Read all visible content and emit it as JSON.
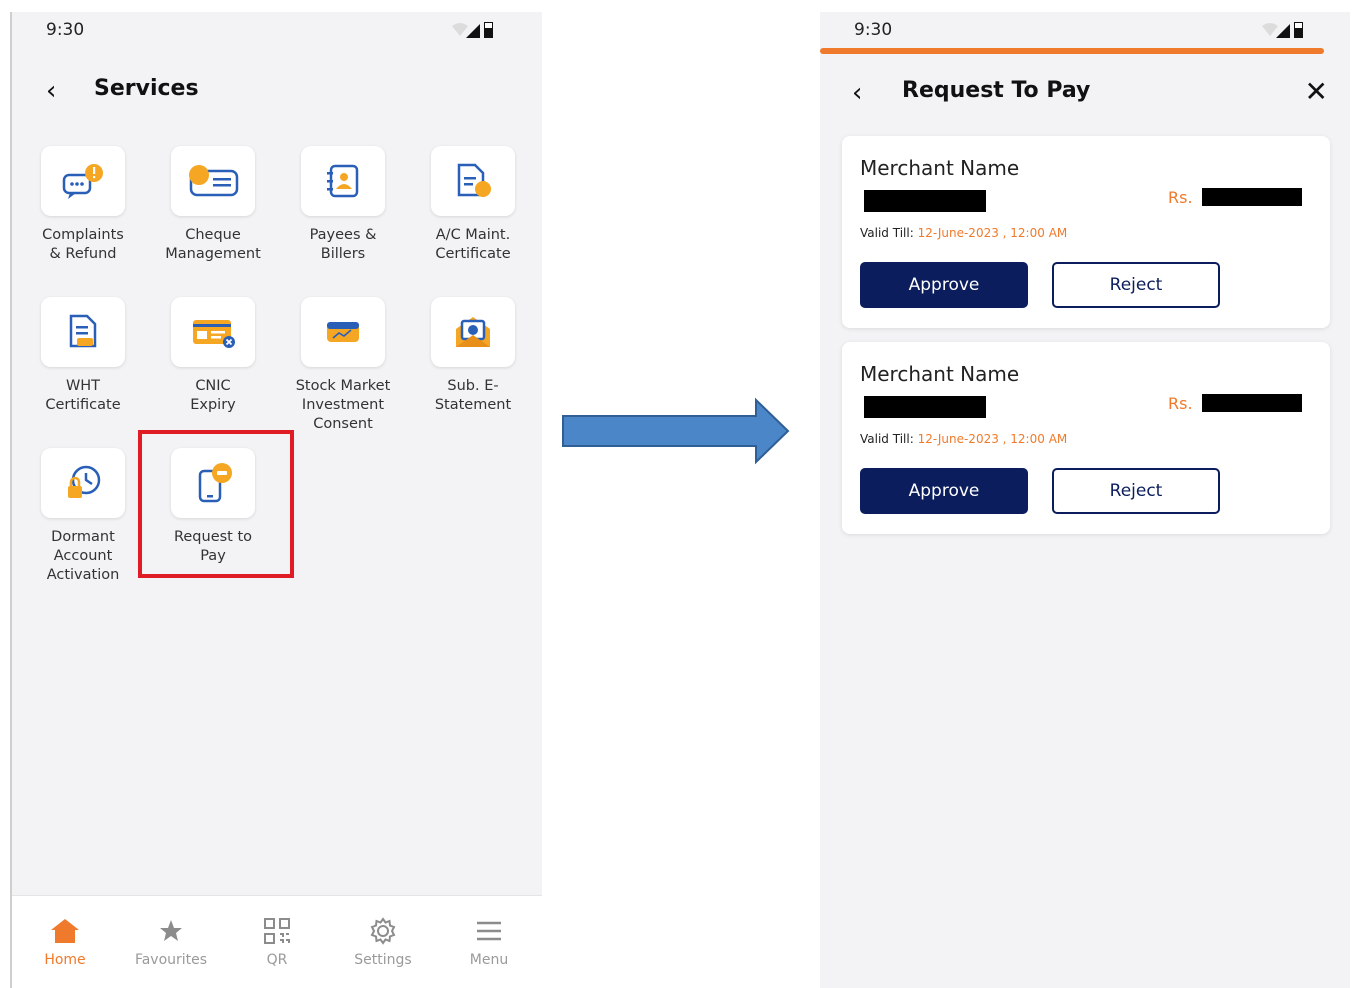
{
  "left_screen": {
    "status_time": "9:30",
    "title": "Services",
    "services": [
      {
        "label": "Complaints\n& Refund",
        "icon": "complaint-chat-icon"
      },
      {
        "label": "Cheque\nManagement",
        "icon": "cheque-icon"
      },
      {
        "label": "Payees &\nBillers",
        "icon": "payee-contact-icon"
      },
      {
        "label": "A/C Maint.\nCertificate",
        "icon": "certificate-document-icon"
      },
      {
        "label": "WHT\nCertificate",
        "icon": "tax-document-icon"
      },
      {
        "label": "CNIC\nExpiry",
        "icon": "id-card-icon"
      },
      {
        "label": "Stock Market\nInvestment\nConsent",
        "icon": "stock-chart-icon"
      },
      {
        "label": "Sub. E-\nStatement",
        "icon": "email-statement-icon"
      },
      {
        "label": "Dormant\nAccount\nActivation",
        "icon": "dormant-lock-clock-icon"
      },
      {
        "label": "Request to\nPay",
        "icon": "request-to-pay-phone-icon"
      }
    ],
    "bottom_nav": [
      {
        "label": "Home",
        "icon": "home-icon",
        "active": true
      },
      {
        "label": "Favourites",
        "icon": "star-icon",
        "active": false
      },
      {
        "label": "QR",
        "icon": "qr-code-icon",
        "active": false
      },
      {
        "label": "Settings",
        "icon": "gear-icon",
        "active": false
      },
      {
        "label": "Menu",
        "icon": "hamburger-menu-icon",
        "active": false
      }
    ]
  },
  "right_screen": {
    "status_time": "9:30",
    "title": "Request To Pay",
    "requests": [
      {
        "merchant_label": "Merchant Name",
        "currency": "Rs.",
        "valid_prefix": "Valid Till:",
        "valid_date": "12-June-2023 , 12:00 AM",
        "approve_label": "Approve",
        "reject_label": "Reject"
      },
      {
        "merchant_label": "Merchant Name",
        "currency": "Rs.",
        "valid_prefix": "Valid Till:",
        "valid_date": "12-June-2023 , 12:00 AM",
        "approve_label": "Approve",
        "reject_label": "Reject"
      }
    ]
  },
  "colors": {
    "accent_orange": "#f07a2b",
    "navy": "#0b1d5c",
    "highlight_red": "#e01b24",
    "arrow_blue": "#4a86c8"
  }
}
